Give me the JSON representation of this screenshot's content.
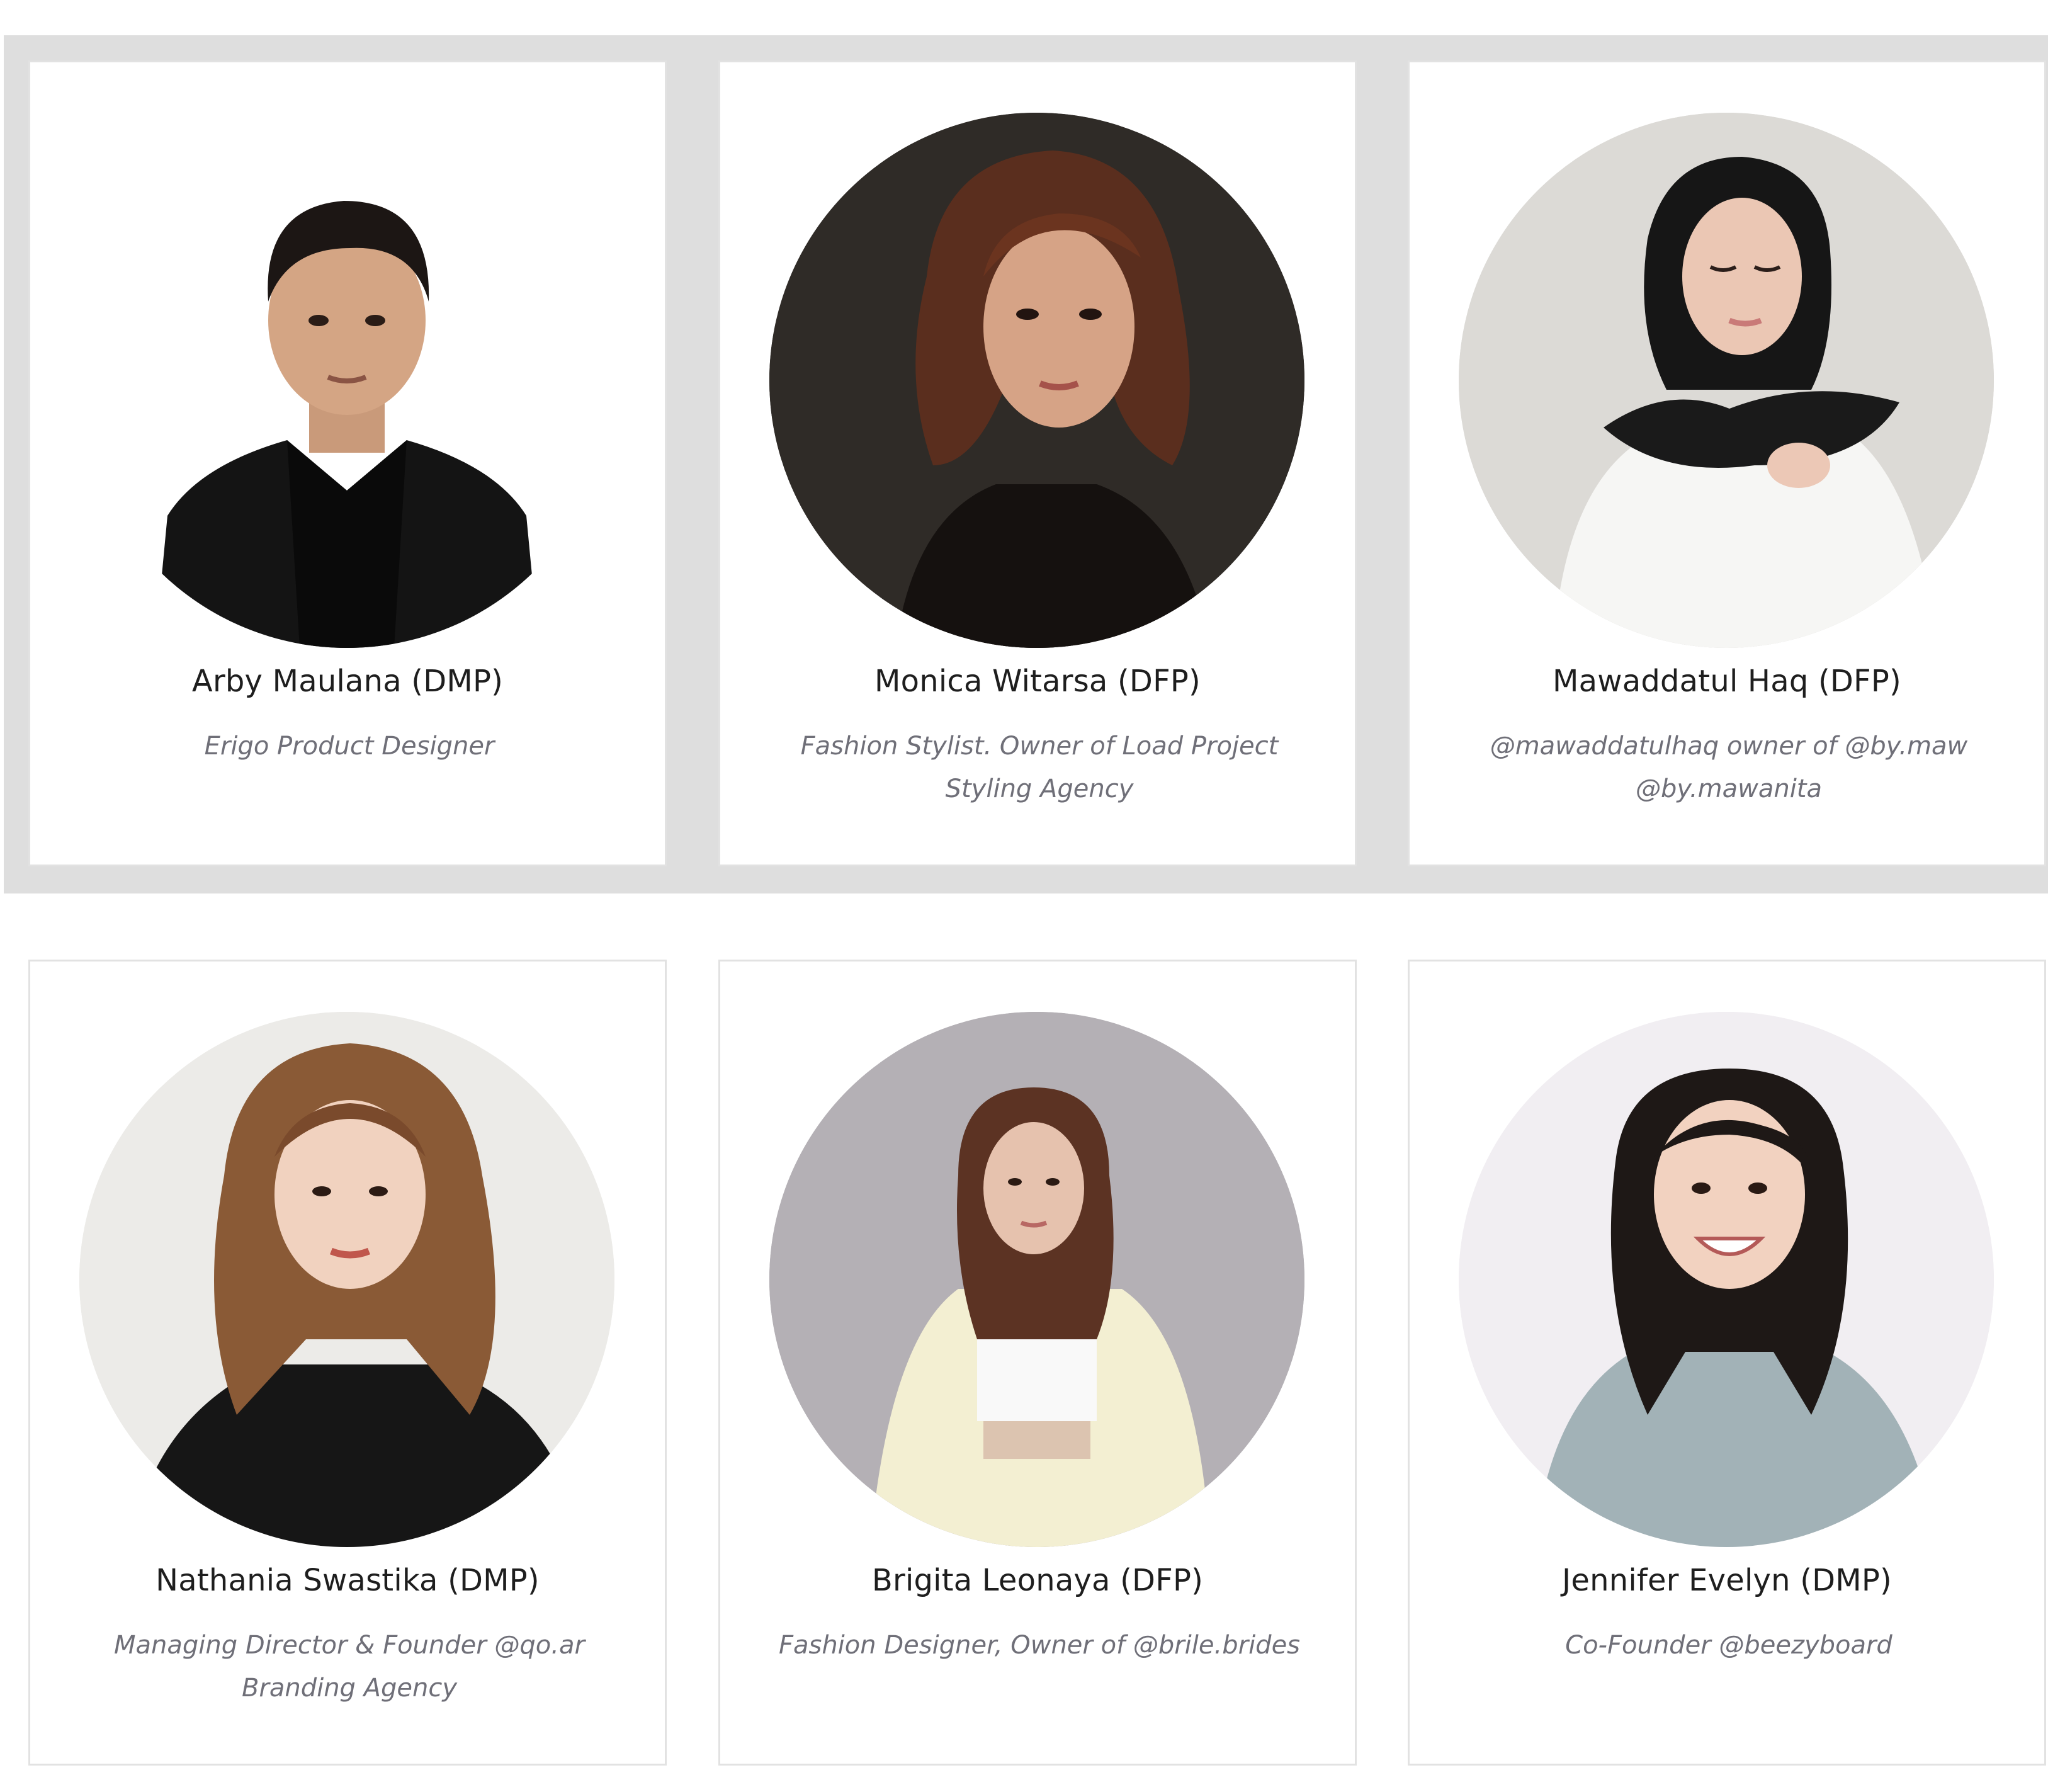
{
  "team": {
    "members": [
      {
        "name": "Arby Maulana (DMP)",
        "role": "Erigo Product Designer"
      },
      {
        "name": "Monica Witarsa (DFP)",
        "role": "Fashion Stylist. Owner of Load Project Styling Agency"
      },
      {
        "name": "Mawaddatul Haq (DFP)",
        "role": "@mawaddatulhaq owner of @by.maw @by.mawanita"
      },
      {
        "name": "Nathania Swastika (DMP)",
        "role": "Managing Director & Founder @qo.ar Branding Agency"
      },
      {
        "name": "Brigita Leonaya (DFP)",
        "role": "Fashion Designer, Owner of @brile.brides"
      },
      {
        "name": "Jennifer Evelyn (DMP)",
        "role": "Co-Founder @beezyboard"
      }
    ]
  },
  "colors": {
    "band_background": "#dedede",
    "card_border": "#e2e2e2",
    "name_text": "#1e1e1e",
    "role_text": "#6f6f78"
  }
}
